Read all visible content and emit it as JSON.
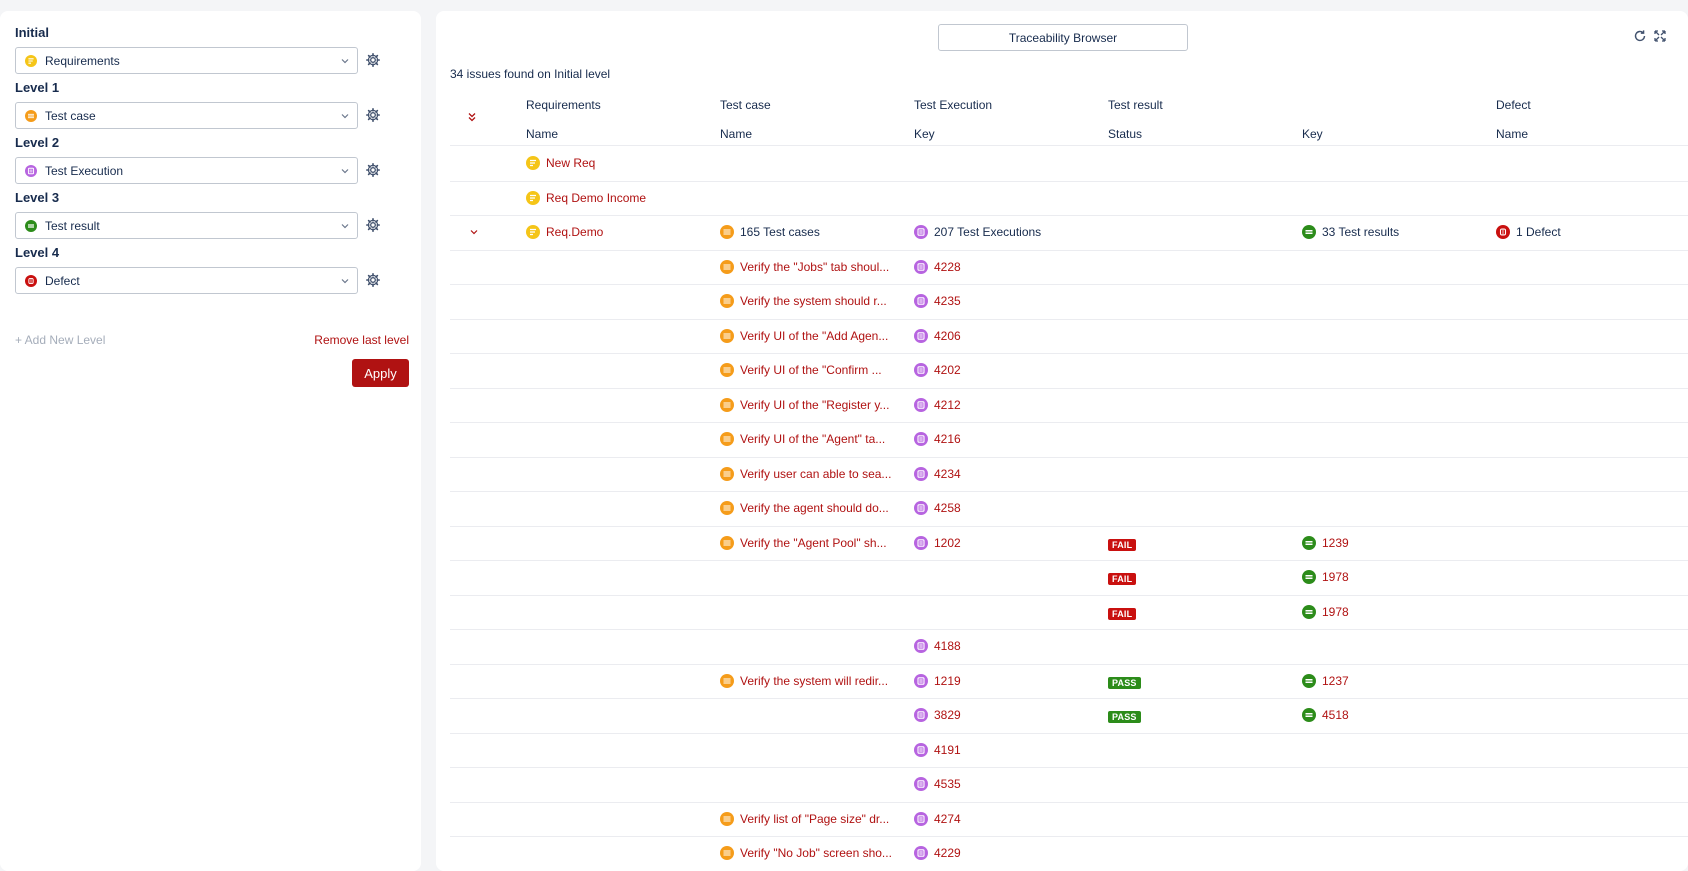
{
  "levels": [
    {
      "title": "Initial",
      "value": "Requirements",
      "icon": "requirement-icon",
      "color": "#f5c518"
    },
    {
      "title": "Level 1",
      "value": "Test case",
      "icon": "test-case-icon",
      "color": "#f59c1a"
    },
    {
      "title": "Level 2",
      "value": "Test Execution",
      "icon": "test-execution-icon",
      "color": "#b764e0"
    },
    {
      "title": "Level 3",
      "value": "Test result",
      "icon": "test-result-icon",
      "color": "#2c8c1a"
    },
    {
      "title": "Level 4",
      "value": "Defect",
      "icon": "defect-icon",
      "color": "#c9100f"
    }
  ],
  "add_level_label": "+ Add New Level",
  "remove_level_label": "Remove last level",
  "apply_label": "Apply",
  "browser_title": "Traceability Browser",
  "summary": "34 issues found on Initial level",
  "headers_top": [
    "Requirements",
    "Test case",
    "Test Execution",
    "Test result",
    "",
    "Defect"
  ],
  "headers_sub": [
    "Name",
    "Name",
    "Key",
    "Status",
    "Key",
    "Name"
  ],
  "req_rows": [
    "New Req",
    "Req Demo Income"
  ],
  "group_row": {
    "requirement": "Req.Demo",
    "test_cases": "165 Test cases",
    "executions": "207 Test Executions",
    "results": "33 Test results",
    "defects": "1 Defect"
  },
  "rows": [
    {
      "tc": "Verify the \"Jobs\" tab shoul...",
      "te": "4228",
      "status": "",
      "tr": ""
    },
    {
      "tc": "Verify the system should r...",
      "te": "4235",
      "status": "",
      "tr": ""
    },
    {
      "tc": "Verify UI of the \"Add Agen...",
      "te": "4206",
      "status": "",
      "tr": ""
    },
    {
      "tc": "Verify UI of the \"Confirm ...",
      "te": "4202",
      "status": "",
      "tr": ""
    },
    {
      "tc": "Verify UI of the \"Register y...",
      "te": "4212",
      "status": "",
      "tr": ""
    },
    {
      "tc": "Verify UI of the \"Agent\" ta...",
      "te": "4216",
      "status": "",
      "tr": ""
    },
    {
      "tc": "Verify user can able to sea...",
      "te": "4234",
      "status": "",
      "tr": ""
    },
    {
      "tc": "Verify the agent should do...",
      "te": "4258",
      "status": "",
      "tr": ""
    },
    {
      "tc": "Verify the \"Agent Pool\" sh...",
      "te": "1202",
      "status": "FAIL",
      "tr": "1239"
    },
    {
      "tc": "",
      "te": "",
      "status": "FAIL",
      "tr": "1978"
    },
    {
      "tc": "",
      "te": "",
      "status": "FAIL",
      "tr": "1978"
    },
    {
      "tc": "",
      "te": "4188",
      "status": "",
      "tr": ""
    },
    {
      "tc": "Verify the system will redir...",
      "te": "1219",
      "status": "PASS",
      "tr": "1237"
    },
    {
      "tc": "",
      "te": "3829",
      "status": "PASS",
      "tr": "4518"
    },
    {
      "tc": "",
      "te": "4191",
      "status": "",
      "tr": ""
    },
    {
      "tc": "",
      "te": "4535",
      "status": "",
      "tr": ""
    },
    {
      "tc": "Verify list of \"Page size\" dr...",
      "te": "4274",
      "status": "",
      "tr": ""
    },
    {
      "tc": "Verify \"No Job\" screen sho...",
      "te": "4229",
      "status": "",
      "tr": ""
    }
  ]
}
